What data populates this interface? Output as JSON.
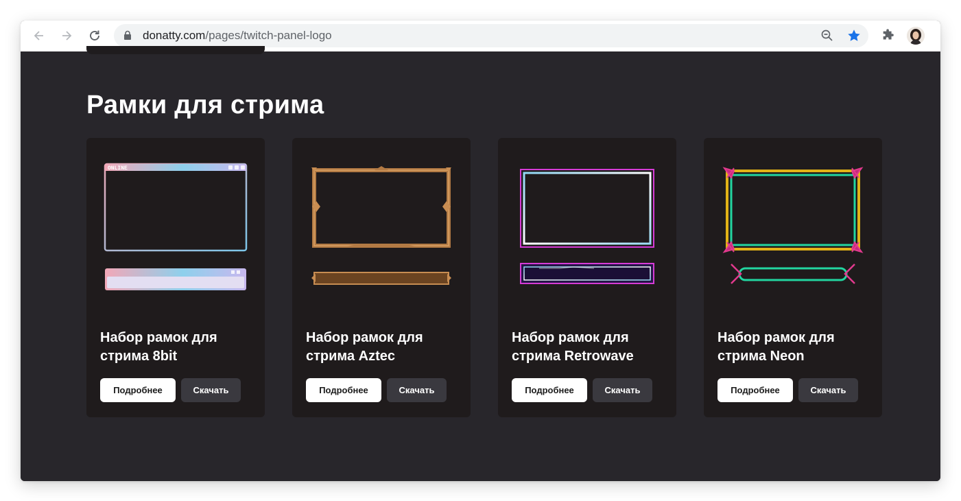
{
  "browser": {
    "url_host": "donatty.com",
    "url_path": "/pages/twitch-panel-logo",
    "icons": [
      "back-icon",
      "forward-icon",
      "reload-icon",
      "lock-icon",
      "zoom-out-icon",
      "bookmark-star-icon",
      "extensions-icon",
      "profile-avatar"
    ],
    "star_color": "#1a73e8"
  },
  "page": {
    "section_title": "Рамки для стрима",
    "cards": [
      {
        "title": "Набор рамок для стрима 8bit",
        "more_label": "Подробнее",
        "download_label": "Скачать"
      },
      {
        "title": "Набор рамок для стрима Aztec",
        "more_label": "Подробнее",
        "download_label": "Скачать"
      },
      {
        "title": "Набор рамок для стрима Retrowave",
        "more_label": "Подробнее",
        "download_label": "Скачать"
      },
      {
        "title": "Набор рамок для стрима Neon",
        "more_label": "Подробнее",
        "download_label": "Скачать"
      }
    ],
    "preview_labels": {
      "online": "ONLINE"
    }
  },
  "colors": {
    "page_bg": "#28262b",
    "card_bg": "#1f1b1c",
    "button_primary_bg": "#ffffff",
    "button_secondary_bg": "#3a393f"
  }
}
